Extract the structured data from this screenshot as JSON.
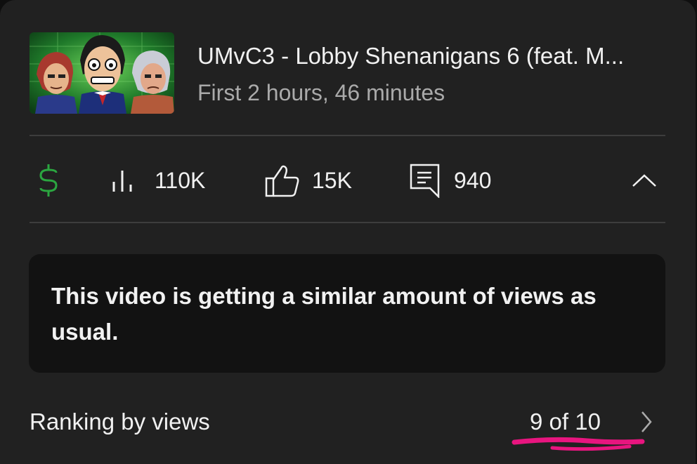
{
  "video": {
    "title": "UMvC3 - Lobby Shenanigans 6 (feat. M...",
    "subtitle": "First 2 hours, 46 minutes",
    "thumbnail_icon": "video-thumbnail"
  },
  "stats": {
    "revenue_icon": "dollar-icon",
    "views_icon": "views-bars-icon",
    "views": "110K",
    "likes_icon": "thumbs-up-icon",
    "likes": "15K",
    "comments_icon": "comment-icon",
    "comments": "940",
    "collapse_icon": "chevron-up-icon"
  },
  "info": {
    "message": "This video is getting a similar amount of views as usual."
  },
  "ranking": {
    "label": "Ranking by views",
    "value": "9 of 10",
    "chevron_icon": "chevron-right-icon"
  },
  "colors": {
    "background": "#212121",
    "info_box": "#121212",
    "text_primary": "#f1f1f1",
    "text_secondary": "#aaaaaa",
    "accent_green": "#2ba640",
    "annotation_pink": "#e8157f"
  }
}
